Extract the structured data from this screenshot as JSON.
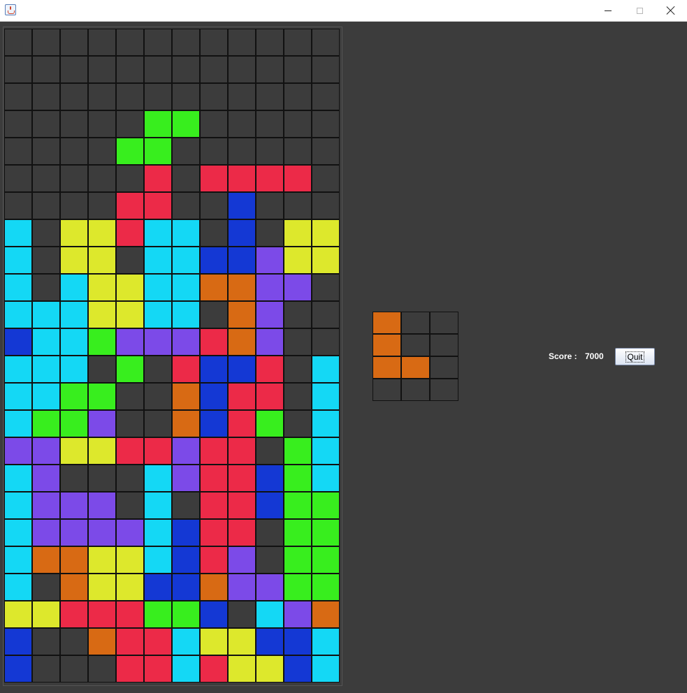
{
  "window": {
    "app_icon": "java-cup-icon"
  },
  "colors": {
    "E": "#3c3c3c",
    "C": "#14d8f5",
    "Y": "#dde82c",
    "G": "#38ee1e",
    "R": "#ec2a48",
    "B": "#1438d4",
    "P": "#7c4ae8",
    "O": "#d86a14"
  },
  "board": {
    "columns": 12,
    "rows": [
      "EEEEEEEEEEEE",
      "EEEEEEEEEEEE",
      "EEEEEEEEEEEE",
      "EEEEEGGEEEEE",
      "EEEEGGEEEEEE",
      "EEEEERERRRRE",
      "EEEERREEBEEE",
      "CEYYRCCEBEYY",
      "CEYYECCBBPYY",
      "CECYYCCOOPPE",
      "CCCYYCCEOPEE",
      "BCCGPPPROPEE",
      "CCCEGERBBREC",
      "CCGGEEOBRREC",
      "CGGPEEOBRGEC",
      "PPYYRRPRREGC",
      "CPEEECPRRBGC",
      "CPPPECERRBGG",
      "CPPPPCBRREGG",
      "COOYYCBRPEGG",
      "CEOYYBBOPPGG",
      "YYRRRGGBECPO",
      "BEEORRCYYBBC",
      "BEEERRCRYYBC"
    ]
  },
  "preview": {
    "columns": 3,
    "rows": [
      "OEE",
      "OEE",
      "OOE",
      "EEE"
    ]
  },
  "score": {
    "label": "Score :",
    "value": "7000"
  },
  "quit_label": "Quit"
}
